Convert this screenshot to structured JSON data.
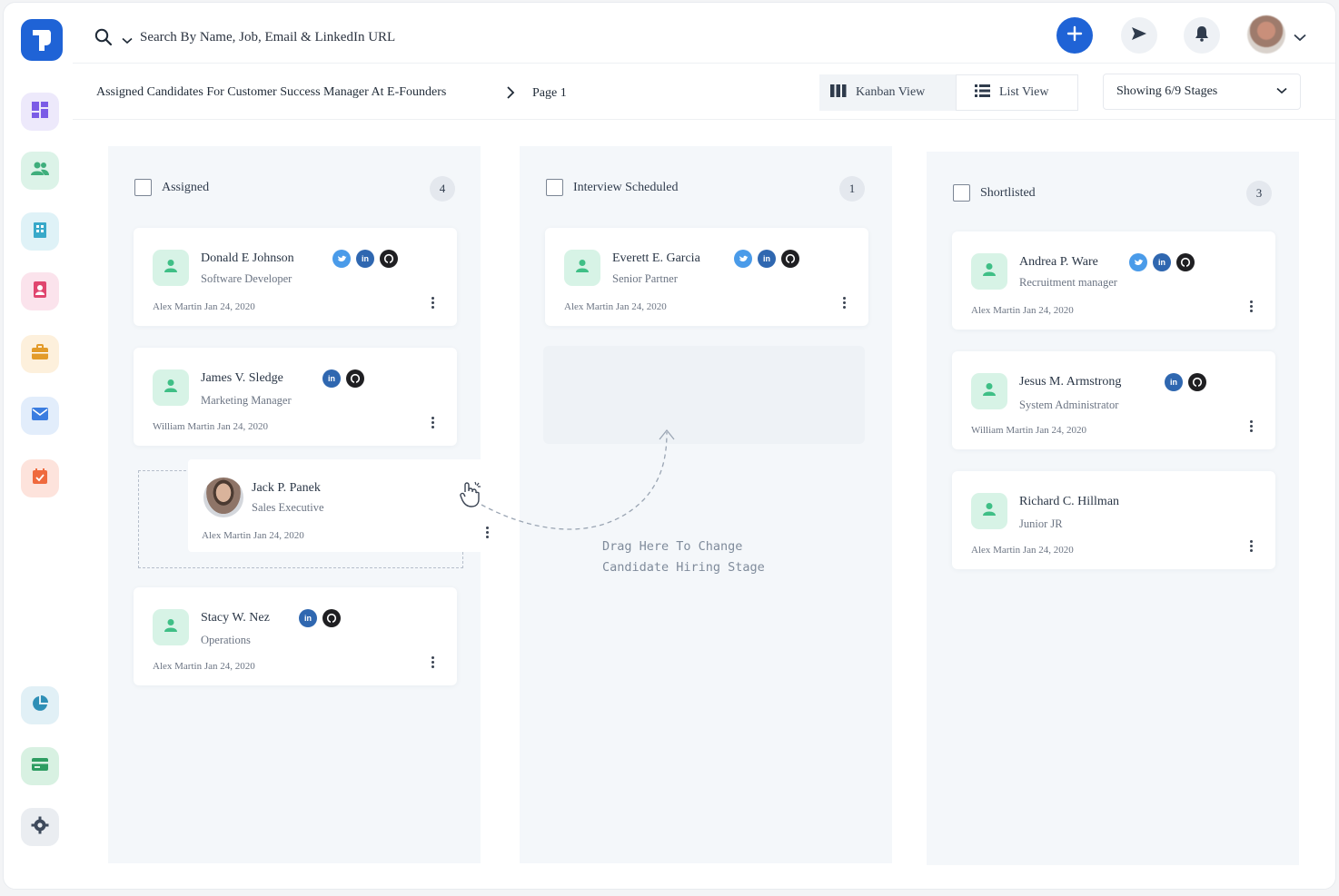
{
  "search": {
    "placeholder": "Search By Name, Job, Email & LinkedIn URL"
  },
  "breadcrumb": {
    "title": "Assigned Candidates For Customer Success Manager At E-Founders",
    "page": "Page 1"
  },
  "views": {
    "kanban": "Kanban View",
    "list": "List View"
  },
  "stages_select": "Showing 6/9 Stages",
  "columns": [
    {
      "title": "Assigned",
      "count": "4",
      "cards": [
        {
          "name": "Donald E Johnson",
          "role": "Software Developer",
          "meta": "Alex Martin Jan 24, 2020",
          "socials": [
            "twitter",
            "linkedin",
            "github"
          ]
        },
        {
          "name": "James V. Sledge",
          "role": "Marketing Manager",
          "meta": "William Martin Jan 24, 2020",
          "socials": [
            "linkedin",
            "github"
          ]
        },
        {
          "name": "Stacy W. Nez",
          "role": "Operations",
          "meta": "Alex Martin Jan 24, 2020",
          "socials": [
            "linkedin",
            "github"
          ]
        }
      ]
    },
    {
      "title": "Interview Scheduled",
      "count": "1",
      "cards": [
        {
          "name": "Everett E. Garcia",
          "role": "Senior Partner",
          "meta": "Alex Martin Jan 24, 2020",
          "socials": [
            "twitter",
            "linkedin",
            "github"
          ]
        }
      ]
    },
    {
      "title": "Shortlisted",
      "count": "3",
      "cards": [
        {
          "name": "Andrea P. Ware",
          "role": "Recruitment manager",
          "meta": "Alex Martin Jan 24, 2020",
          "socials": [
            "twitter",
            "linkedin",
            "github"
          ]
        },
        {
          "name": "Jesus M. Armstrong",
          "role": "System Administrator",
          "meta": "William Martin Jan 24, 2020",
          "socials": [
            "linkedin",
            "github"
          ]
        },
        {
          "name": "Richard C. Hillman",
          "role": "Junior JR",
          "meta": "Alex Martin Jan 24, 2020",
          "socials": []
        }
      ]
    }
  ],
  "dragging_card": {
    "name": "Jack P. Panek",
    "role": "Sales Executive",
    "meta": "Alex Martin Jan 24, 2020"
  },
  "drag_hint": {
    "line1": "Drag Here To Change",
    "line2": "Candidate Hiring Stage"
  },
  "linkedin_glyph": "in",
  "colors": {
    "primary": "#1f63d6",
    "avatar_bg": "#d7f3e6",
    "avatar_fg": "#3fbf86",
    "column_bg": "#f4f7fa"
  },
  "sidebar_icons": [
    "dashboard-icon",
    "candidates-icon",
    "companies-icon",
    "contacts-icon",
    "jobs-icon",
    "mail-icon",
    "calendar-icon",
    "reports-icon",
    "billing-icon",
    "settings-icon"
  ]
}
